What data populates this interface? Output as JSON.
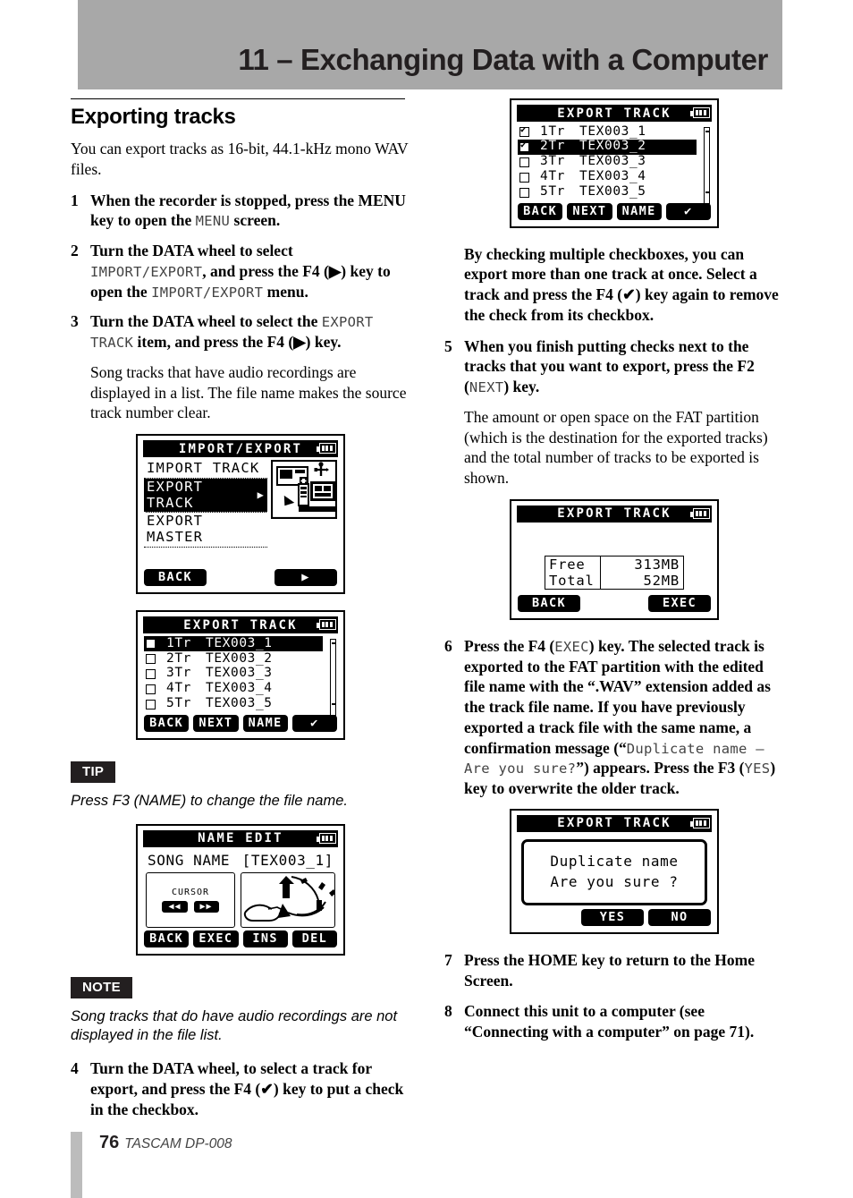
{
  "header": {
    "title": "11 – Exchanging Data with a Computer"
  },
  "section": {
    "title": "Exporting tracks",
    "intro": "You can export tracks as 16-bit, 44.1-kHz mono WAV files."
  },
  "steps": {
    "s1": {
      "num": "1",
      "text_a": "When the recorder is stopped, press the MENU key to open the ",
      "lcd_a": "MENU",
      "text_b": " screen."
    },
    "s2": {
      "num": "2",
      "text_a": "Turn the DATA wheel to select ",
      "lcd_a": "IMPORT/EXPORT",
      "text_b": ", and press the F4 (▶) key to open the ",
      "lcd_b": "IMPORT/EXPORT",
      "text_c": " menu."
    },
    "s3": {
      "num": "3",
      "text_a": "Turn the DATA wheel to select the ",
      "lcd_a": "EXPORT TRACK",
      "text_b": " item, and press the F4 (▶) key.",
      "para": "Song tracks that have audio recordings are displayed in a list. The file name makes the source track number clear."
    },
    "s4": {
      "num": "4",
      "text_a": "Turn the DATA wheel, to select a track for export, and press the F4 (✔) key to put a check in the checkbox."
    },
    "s4_note": "By checking multiple checkboxes, you can export more than one track at once. Select a track and press the F4 (✔) key again to remove the check from its checkbox.",
    "s5": {
      "num": "5",
      "text_a": "When you finish putting checks next to the tracks that you want to export, press the F2 (",
      "lcd_a": "NEXT",
      "text_b": ") key.",
      "para": "The amount or open space on the FAT partition (which is the destination for the exported tracks) and the total number of tracks to be exported is shown."
    },
    "s6": {
      "num": "6",
      "text_a": "Press the F4 (",
      "lcd_a": "EXEC",
      "text_b": ") key. The selected track is exported to the FAT partition with the edited file name with the “.WAV” extension added as the track file name. If you have previously exported a track file with the same name, a confirmation message (“",
      "lcd_b": "Duplicate name – Are you sure?",
      "text_c": "”) appears. Press the F3 (",
      "lcd_c": "YES",
      "text_d": ") key to overwrite the older track."
    },
    "s7": {
      "num": "7",
      "text_a": "Press the HOME key to return to the Home Screen."
    },
    "s8": {
      "num": "8",
      "text_a": "Connect this unit to a computer (see “Connecting with a computer” on page 71)."
    }
  },
  "tip": {
    "badge": "TIP",
    "text": "Press F3 (NAME) to change the file name."
  },
  "note": {
    "badge": "NOTE",
    "text": "Song tracks that do have audio recordings are not displayed in the file list."
  },
  "lcd_import_export": {
    "title": "IMPORT/EXPORT",
    "rows": [
      {
        "label": "IMPORT TRACK",
        "selected": false,
        "arrow": ""
      },
      {
        "label": "EXPORT TRACK",
        "selected": true,
        "arrow": "▶"
      },
      {
        "label": "EXPORT MASTER",
        "selected": false,
        "arrow": ""
      }
    ],
    "fkeys": {
      "f1": "BACK",
      "f4": "▶"
    }
  },
  "lcd_track_list_1": {
    "title": "EXPORT TRACK",
    "rows": [
      {
        "checked": false,
        "track": "1Tr",
        "name": "TEX003_1",
        "selected": true
      },
      {
        "checked": false,
        "track": "2Tr",
        "name": "TEX003_2",
        "selected": false
      },
      {
        "checked": false,
        "track": "3Tr",
        "name": "TEX003_3",
        "selected": false
      },
      {
        "checked": false,
        "track": "4Tr",
        "name": "TEX003_4",
        "selected": false
      },
      {
        "checked": false,
        "track": "5Tr",
        "name": "TEX003_5",
        "selected": false
      }
    ],
    "fkeys": {
      "f1": "BACK",
      "f2": "NEXT",
      "f3": "NAME",
      "f4": "✔"
    }
  },
  "lcd_track_list_2": {
    "title": "EXPORT TRACK",
    "rows": [
      {
        "checked": true,
        "track": "1Tr",
        "name": "TEX003_1",
        "selected": false
      },
      {
        "checked": true,
        "track": "2Tr",
        "name": "TEX003_2",
        "selected": true
      },
      {
        "checked": false,
        "track": "3Tr",
        "name": "TEX003_3",
        "selected": false
      },
      {
        "checked": false,
        "track": "4Tr",
        "name": "TEX003_4",
        "selected": false
      },
      {
        "checked": false,
        "track": "5Tr",
        "name": "TEX003_5",
        "selected": false
      }
    ],
    "fkeys": {
      "f1": "BACK",
      "f2": "NEXT",
      "f3": "NAME",
      "f4": "✔"
    }
  },
  "lcd_name_edit": {
    "title": "NAME EDIT",
    "field_label": "SONG NAME",
    "field_value": "[TEX003_1]",
    "cursor_label": "CURSOR",
    "cursor_left": "◀◀",
    "cursor_right": "▶▶",
    "fkeys": {
      "f1": "BACK",
      "f2": "EXEC",
      "f3": "INS",
      "f4": "DEL"
    }
  },
  "lcd_free_total": {
    "title": "EXPORT TRACK",
    "rows": [
      {
        "key": "Free",
        "value": "313MB"
      },
      {
        "key": "Total",
        "value": "52MB"
      }
    ],
    "fkeys": {
      "f1": "BACK",
      "f4": "EXEC"
    }
  },
  "lcd_duplicate": {
    "title": "EXPORT TRACK",
    "message_line1": "Duplicate name",
    "message_line2": "Are you sure ?",
    "fkeys": {
      "f3": "YES",
      "f4": "NO"
    }
  },
  "footer": {
    "page": "76",
    "model": "TASCAM  DP-008"
  }
}
